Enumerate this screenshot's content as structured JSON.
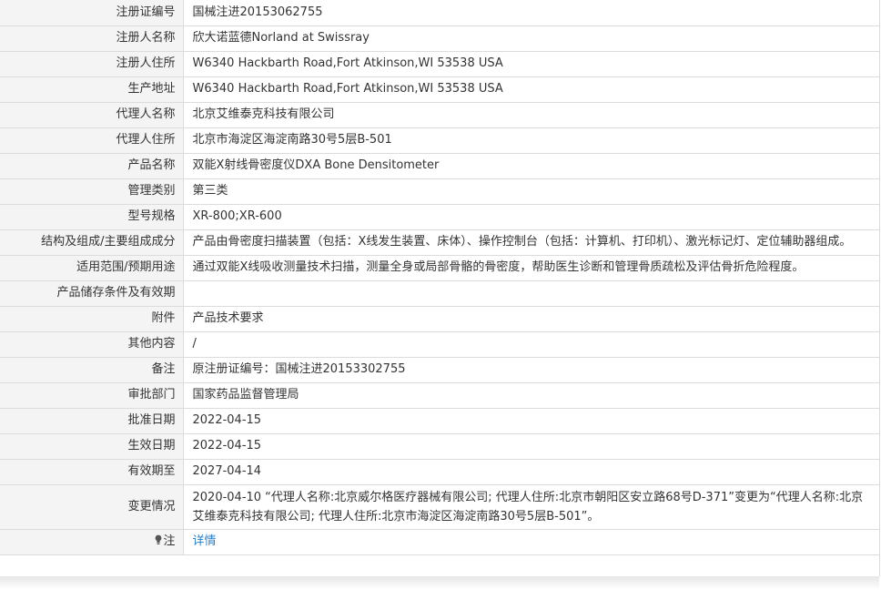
{
  "rows": [
    {
      "label": "注册证编号",
      "value": "国械注进20153062755"
    },
    {
      "label": "注册人名称",
      "value": "欣大诺蓝德Norland at Swissray"
    },
    {
      "label": "注册人住所",
      "value": "W6340 Hackbarth Road,Fort Atkinson,WI 53538 USA"
    },
    {
      "label": "生产地址",
      "value": "W6340 Hackbarth Road,Fort Atkinson,WI 53538 USA"
    },
    {
      "label": "代理人名称",
      "value": "北京艾维泰克科技有限公司"
    },
    {
      "label": "代理人住所",
      "value": "北京市海淀区海淀南路30号5层B-501"
    },
    {
      "label": "产品名称",
      "value": "双能X射线骨密度仪DXA Bone Densitometer"
    },
    {
      "label": "管理类别",
      "value": "第三类"
    },
    {
      "label": "型号规格",
      "value": "XR-800;XR-600"
    },
    {
      "label": "结构及组成/主要组成成分",
      "value": "产品由骨密度扫描装置（包括：X线发生装置、床体）、操作控制台（包括：计算机、打印机）、激光标记灯、定位辅助器组成。"
    },
    {
      "label": "适用范围/预期用途",
      "value": "通过双能X线吸收测量技术扫描，测量全身或局部骨骼的骨密度，帮助医生诊断和管理骨质疏松及评估骨折危险程度。"
    },
    {
      "label": "产品储存条件及有效期",
      "value": ""
    },
    {
      "label": "附件",
      "value": "产品技术要求"
    },
    {
      "label": "其他内容",
      "value": "/"
    },
    {
      "label": "备注",
      "value": "原注册证编号：国械注进20153302755"
    },
    {
      "label": "审批部门",
      "value": "国家药品监督管理局"
    },
    {
      "label": "批准日期",
      "value": "2022-04-15"
    },
    {
      "label": "生效日期",
      "value": "2022-04-15"
    },
    {
      "label": "有效期至",
      "value": "2027-04-14"
    },
    {
      "label": "变更情况",
      "value": "2020-04-10 “代理人名称:北京威尔格医疗器械有限公司; 代理人住所:北京市朝阳区安立路68号D-371”变更为“代理人名称:北京艾维泰克科技有限公司; 代理人住所:北京市海淀区海淀南路30号5层B-501”。"
    }
  ],
  "note": {
    "label": "注",
    "link_text": "详情",
    "icon": "lightbulb-icon"
  }
}
